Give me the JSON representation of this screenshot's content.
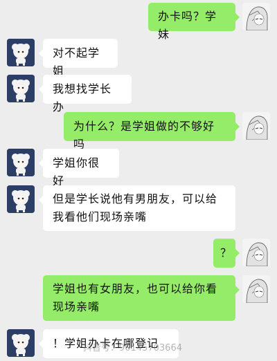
{
  "messages": [
    {
      "side": "right",
      "text": "办卡吗？学妹",
      "avatar": "anime-girl-avatar"
    },
    {
      "side": "left",
      "text": "对不起学姐",
      "avatar": "sheep-avatar"
    },
    {
      "side": "left",
      "text": "我想找学长办",
      "avatar": "sheep-avatar"
    },
    {
      "side": "right",
      "text": "为什么？是学姐做的不够好吗",
      "avatar": "anime-girl-avatar"
    },
    {
      "side": "left",
      "text": "学姐你很好",
      "avatar": "sheep-avatar"
    },
    {
      "side": "left",
      "text": "但是学长说他有男朋友，可以给我看他们现场亲嘴",
      "avatar": "sheep-avatar"
    },
    {
      "side": "right",
      "text": "？",
      "avatar": "anime-girl-avatar"
    },
    {
      "side": "right",
      "text": "学姐也有女朋友，也可以给你看现场亲嘴",
      "avatar": "anime-girl-avatar"
    },
    {
      "side": "left",
      "text": "！学姐办卡在哪登记",
      "avatar": "sheep-avatar"
    }
  ],
  "watermark": "抖音号：90145703664",
  "colors": {
    "background": "#ededed",
    "bubble_right": "#95ec69",
    "bubble_left": "#ffffff",
    "sheep_avatar_bg": "#2d3e66"
  }
}
